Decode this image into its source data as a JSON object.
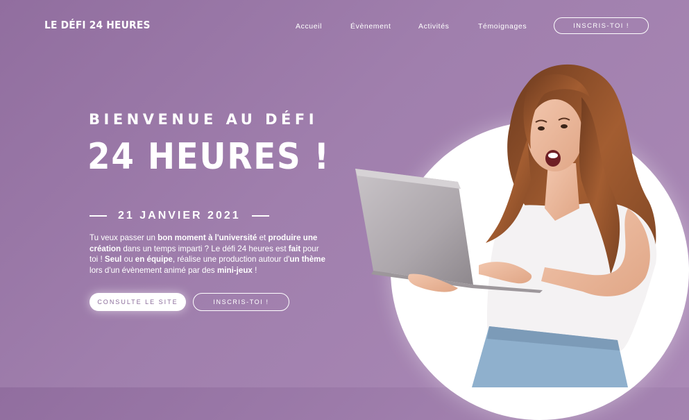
{
  "header": {
    "logo": "LE DÉFI 24 HEURES",
    "nav": [
      "Accueil",
      "Évènement",
      "Activités",
      "Témoignages"
    ],
    "cta": "INSCRIS-TOI !"
  },
  "hero": {
    "kicker": "BIENVENUE AU DÉFI",
    "title": "24 HEURES !",
    "date": "21 JANVIER 2021",
    "description": [
      {
        "t": "Tu veux passer un ",
        "b": false
      },
      {
        "t": "bon moment à l'université",
        "b": true
      },
      {
        "t": " et ",
        "b": false
      },
      {
        "t": "produire une création",
        "b": true
      },
      {
        "t": " dans un temps imparti ? Le défi 24 heures est ",
        "b": false
      },
      {
        "t": "fait",
        "b": true
      },
      {
        "t": " pour toi ! ",
        "b": false
      },
      {
        "t": "Seul",
        "b": true
      },
      {
        "t": " ou ",
        "b": false
      },
      {
        "t": "en équipe",
        "b": true
      },
      {
        "t": ", réalise une production autour d'",
        "b": false
      },
      {
        "t": "un thème",
        "b": true
      },
      {
        "t": " lors d'un évènement animé par des ",
        "b": false
      },
      {
        "t": "mini-jeux",
        "b": true
      },
      {
        "t": " !",
        "b": false
      }
    ],
    "primary_button": "CONSULTE LE SITE",
    "secondary_button": "INSCRIS-TOI !"
  },
  "image": {
    "subject": "woman-with-laptop-photo"
  },
  "colors": {
    "background": "#9c7aaa",
    "accent_text": "#8a6b9a",
    "white": "#ffffff"
  }
}
